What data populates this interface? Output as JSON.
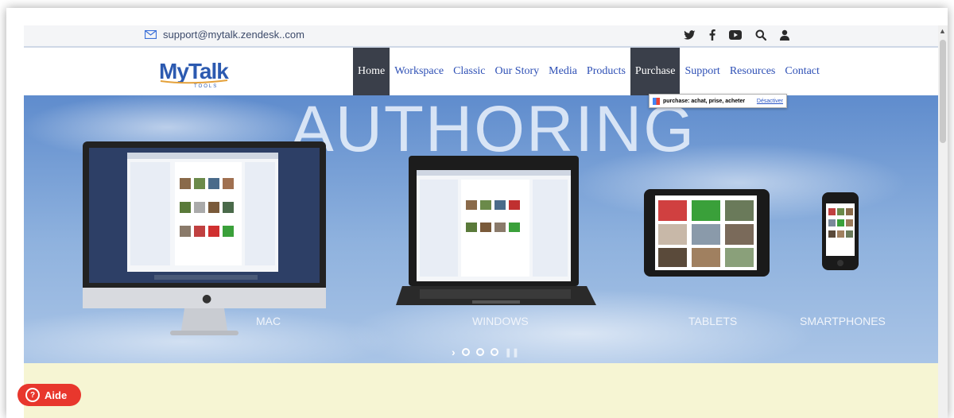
{
  "topbar": {
    "email": "support@mytalk.zendesk..com",
    "social_icons": [
      "twitter-icon",
      "facebook-icon",
      "youtube-icon",
      "search-icon",
      "user-icon"
    ]
  },
  "logo": {
    "main": "MyTalk",
    "sub": "TOOLS"
  },
  "nav": {
    "items": [
      {
        "label": "Home",
        "active": true
      },
      {
        "label": "Workspace"
      },
      {
        "label": "Classic"
      },
      {
        "label": "Our Story"
      },
      {
        "label": "Media"
      },
      {
        "label": "Products"
      },
      {
        "label": "Purchase",
        "hovered": true
      },
      {
        "label": "Support"
      },
      {
        "label": "Resources"
      },
      {
        "label": "Contact"
      }
    ]
  },
  "tooltip": {
    "text": "purchase: achat, prise, acheter",
    "link": "Désactiver"
  },
  "hero": {
    "title": "AUTHORING",
    "labels": {
      "mac": "MAC",
      "windows": "WINDOWS",
      "tablets": "TABLETS",
      "smartphones": "SMARTPHONES"
    }
  },
  "help_button": {
    "label": "Aide"
  },
  "colors": {
    "nav_active_bg": "#3a3f4a",
    "link": "#2d4fb5",
    "aide_bg": "#e8372d",
    "cream": "#f6f5d3"
  }
}
